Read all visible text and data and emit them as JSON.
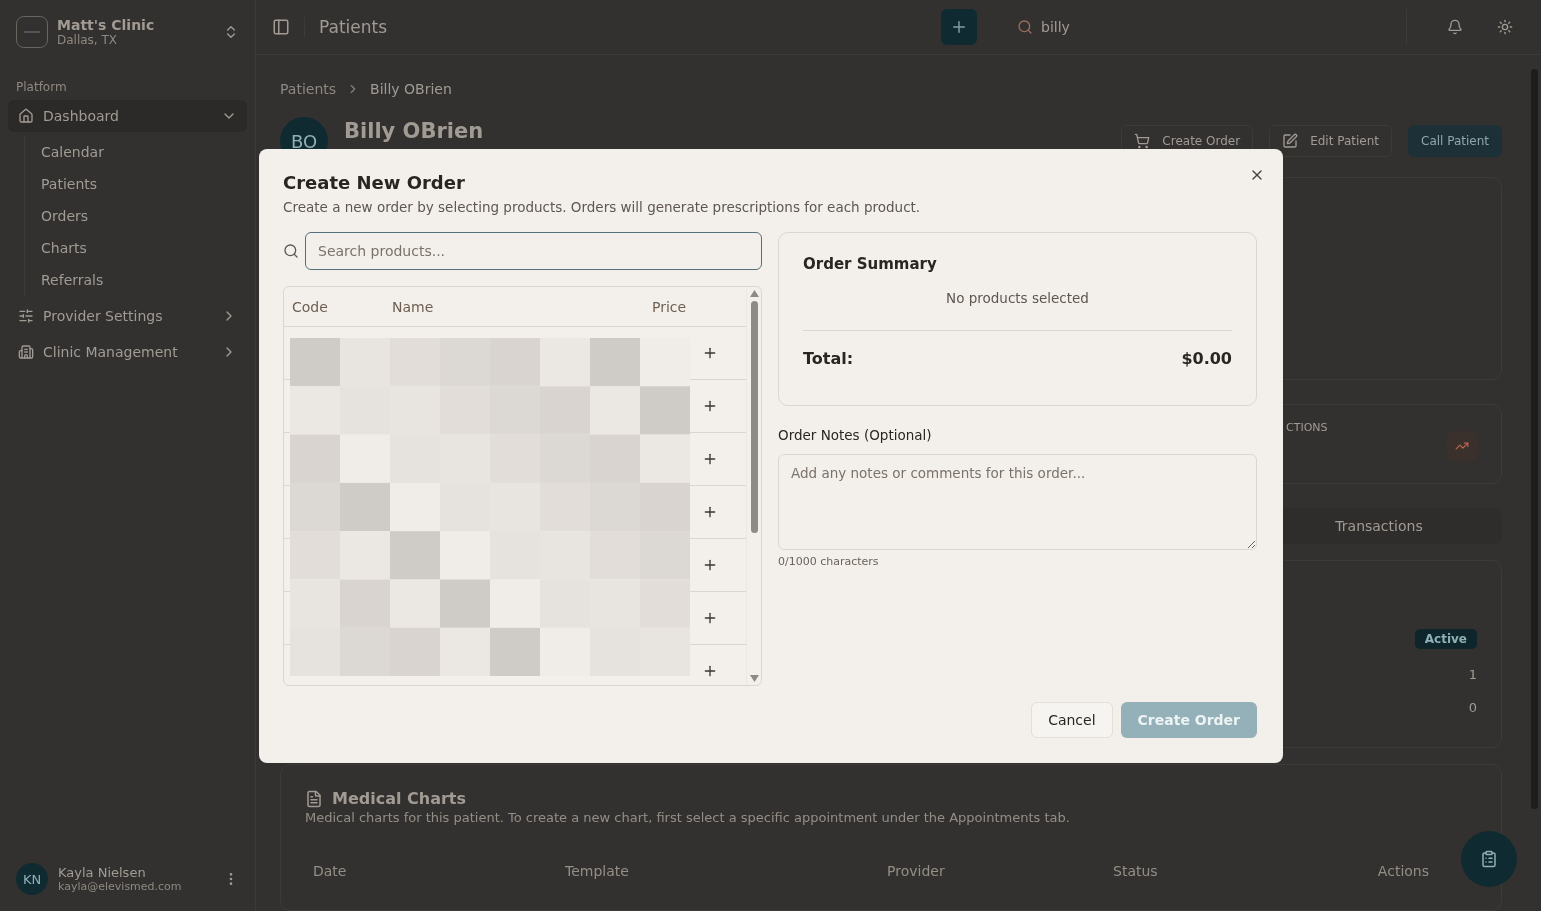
{
  "sidebar": {
    "clinic": {
      "name": "Matt's Clinic",
      "location": "Dallas, TX"
    },
    "section": "Platform",
    "items": [
      {
        "label": "Dashboard",
        "kind": "home",
        "expanded": true,
        "children": [
          {
            "label": "Calendar"
          },
          {
            "label": "Patients"
          },
          {
            "label": "Orders"
          },
          {
            "label": "Charts"
          },
          {
            "label": "Referrals"
          }
        ]
      },
      {
        "label": "Provider Settings",
        "kind": "sliders",
        "expanded": false
      },
      {
        "label": "Clinic Management",
        "kind": "building",
        "expanded": false
      }
    ],
    "user": {
      "initials": "KN",
      "name": "Kayla Nielsen",
      "email": "kayla@elevismed.com"
    }
  },
  "header": {
    "title": "Patients",
    "search": {
      "value": "billy"
    }
  },
  "breadcrumb": [
    "Patients",
    "Billy OBrien"
  ],
  "patient": {
    "initials": "BO",
    "name": "Billy OBrien",
    "actions": [
      {
        "label": "Create Order",
        "kind": "cart"
      },
      {
        "label": "Edit Patient",
        "kind": "edit"
      },
      {
        "label": "Call Patient",
        "kind": "primary"
      }
    ]
  },
  "stat": {
    "label": "CTIONS"
  },
  "tabs": [
    {
      "label": "Transactions",
      "selected": false
    }
  ],
  "details": {
    "status": "Active",
    "values": [
      "1",
      "0"
    ]
  },
  "medical_charts": {
    "title": "Medical Charts",
    "description": "Medical charts for this patient. To create a new chart, first select a specific appointment under the Appointments tab.",
    "columns": [
      "Date",
      "Template",
      "Provider",
      "Status",
      "Actions"
    ]
  },
  "dialog": {
    "title": "Create New Order",
    "subtitle": "Create a new order by selecting products. Orders will generate prescriptions for each product.",
    "search": {
      "placeholder": "Search products..."
    },
    "columns": [
      "Code",
      "Name",
      "Price"
    ],
    "rows": [
      {
        "kind": "redacted"
      },
      {
        "kind": "redacted"
      },
      {
        "kind": "redacted"
      },
      {
        "kind": "redacted"
      },
      {
        "kind": "redacted"
      },
      {
        "kind": "redacted"
      },
      {
        "kind": "redacted"
      }
    ],
    "summary": {
      "title": "Order Summary",
      "empty": "No products selected",
      "total_label": "Total:",
      "total": "$0.00"
    },
    "notes": {
      "label": "Order Notes (Optional)",
      "placeholder": "Add any notes or comments for this order...",
      "count": "0/1000 characters"
    },
    "buttons": [
      {
        "label": "Cancel",
        "kind": "secondary",
        "disabled": false
      },
      {
        "label": "Create Order",
        "kind": "primary",
        "disabled": true
      }
    ]
  }
}
